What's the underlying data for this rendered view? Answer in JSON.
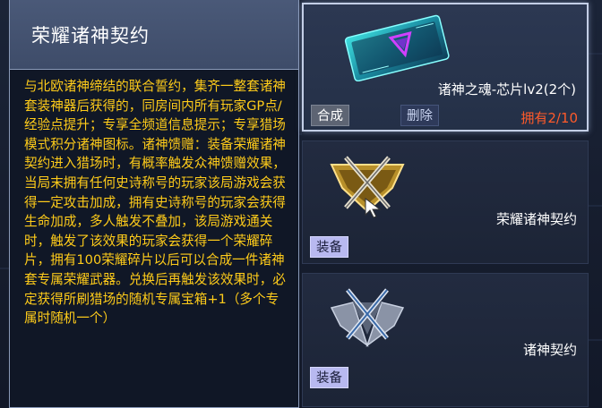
{
  "tooltip": {
    "title": "荣耀诸神契约",
    "description": "与北欧诸神缔结的联合誓约，集齐一整套诸神套装神器后获得的，同房间内所有玩家GP点/经验点提升；专享全频道信息提示；专享猎场模式积分诸神图标。诸神馈赠：装备荣耀诸神契约进入猎场时，有概率触发众神馈赠效果，当局末拥有任何史诗称号的玩家该局游戏会获得一定攻击加成，拥有史诗称号的玩家会获得生命加成，多人触发不叠加，该局游戏通关时，触发了该效果的玩家会获得一个荣耀碎片，拥有100荣耀碎片以后可以合成一件诸神套专属荣耀武器。兑换后再触发该效果时，必定获得所刷猎场的随机专属宝箱+1（多个专属时随机一个）"
  },
  "items": [
    {
      "name": "诸神之魂-芯片lv2(2个)",
      "icon": "chip-card-icon",
      "buttons": {
        "combine": "合成",
        "delete": "删除"
      },
      "owned": "拥有2/10"
    },
    {
      "name": "荣耀诸神契约",
      "icon": "gold-crossed-weapons-badge-icon",
      "buttons": {
        "equip": "装备"
      }
    },
    {
      "name": "诸神契约",
      "icon": "silver-crossed-weapons-badge-icon",
      "buttons": {
        "equip": "装备"
      }
    }
  ],
  "colors": {
    "description_text": "#ffcc1a",
    "owned_text": "#ff5a2a",
    "equip_button": "#b8b9f0"
  }
}
